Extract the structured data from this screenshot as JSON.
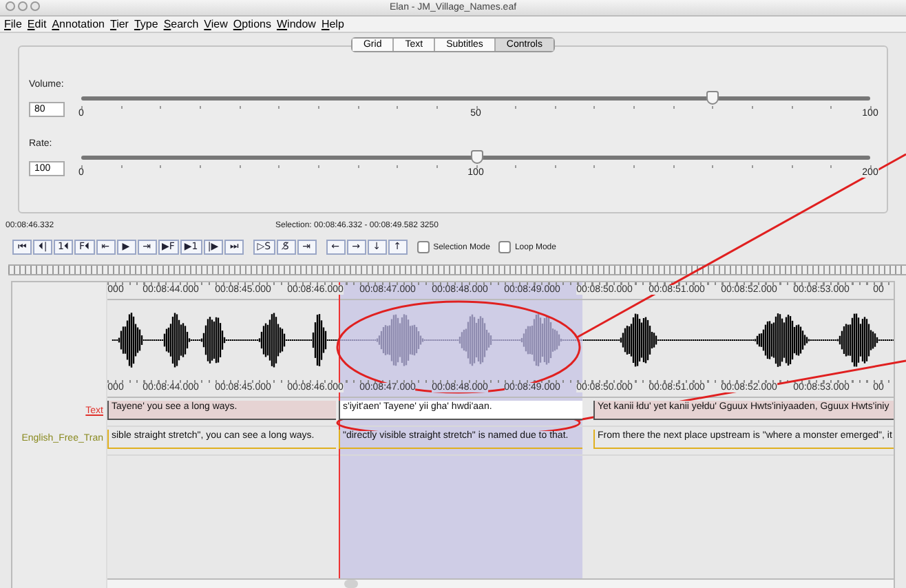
{
  "window": {
    "title": "Elan - JM_Village_Names.eaf"
  },
  "menu": [
    "File",
    "Edit",
    "Annotation",
    "Tier",
    "Type",
    "Search",
    "View",
    "Options",
    "Window",
    "Help"
  ],
  "view_tabs": [
    {
      "label": "Grid",
      "selected": false
    },
    {
      "label": "Text",
      "selected": false
    },
    {
      "label": "Subtitles",
      "selected": false
    },
    {
      "label": "Controls",
      "selected": true
    }
  ],
  "sliders": [
    {
      "label": "Volume:",
      "value": "80",
      "level": 0.8,
      "ticks": [
        "0",
        "50",
        "100"
      ]
    },
    {
      "label": "Rate:",
      "value": "100",
      "level": 0.5,
      "ticks": [
        "0",
        "100",
        "200"
      ]
    }
  ],
  "media_time": "00:08:46.332",
  "selection_info": "Selection: 00:08:46.332 - 00:08:49.582  3250",
  "transport_groups": [
    [
      "⏮",
      "⏴|",
      "1⏴",
      "F⏴",
      "⇤",
      "▶",
      "⇥",
      "▶F",
      "▶1",
      "|▶",
      "⏭"
    ],
    [
      "▷S",
      "S̸",
      "⇥"
    ],
    [
      "←",
      "→",
      "↓",
      "↑"
    ]
  ],
  "checkboxes": [
    {
      "label": "Selection Mode",
      "checked": false
    },
    {
      "label": "Loop Mode",
      "checked": false
    }
  ],
  "ruler_labels": [
    "000",
    "00:08:44.000",
    "00:08:45.000",
    "00:08:46.000",
    "00:08:47.000",
    "00:08:48.000",
    "00:08:49.000",
    "00:08:50.000",
    "00:08:51.000",
    "00:08:52.000",
    "00:08:53.000",
    "00"
  ],
  "ruler_labels_lower": [
    "000",
    "00:08:44.000",
    "00:08:45.000",
    "00:08:46.000",
    "00:08:47.000",
    "00:08:48.000",
    "00:08:49.000",
    "00:08:50.000",
    "00:08:51.000",
    "00:08:52.000",
    "00:08:53.000",
    "00"
  ],
  "tiers": [
    {
      "name": "Text",
      "color": "#e0302a",
      "annotations": [
        {
          "text": "Tayene' you see a long ways.",
          "selected": false
        },
        {
          "text": "s'iyit'aen' Tayene' yii gha' hwdi'aan.",
          "selected": true
        },
        {
          "text": "Yet kanii łdu' yet kanii yełdu' Gguux Hwts'iniyaaden,  Gguux Hwts'iniy",
          "selected": false
        }
      ]
    },
    {
      "name": "English_Free_Tran",
      "color": "#8a8a20",
      "annotations": [
        {
          "text": "sible straight stretch\", you can see a long ways.",
          "selected": false
        },
        {
          "text": "\"directly visible straight stretch\" is named due to that.",
          "selected": false
        },
        {
          "text": "From there the next place upstream is \"where a monster emerged\", it",
          "selected": false
        }
      ]
    }
  ]
}
